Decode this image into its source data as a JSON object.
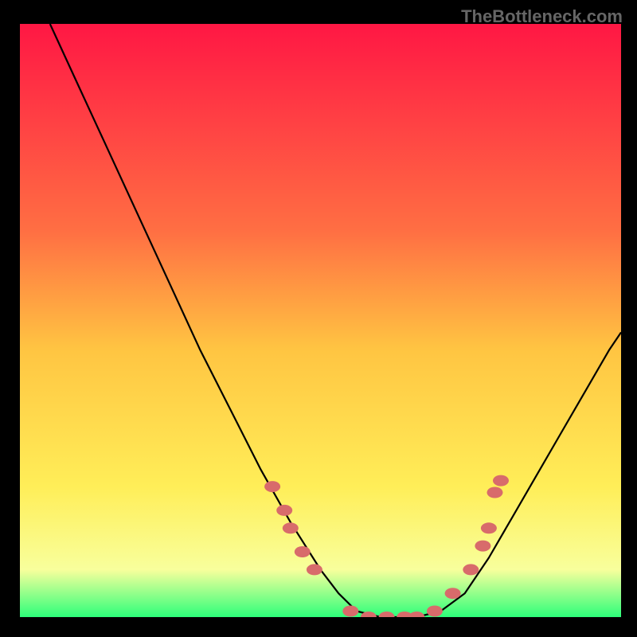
{
  "watermark": "TheBottleneck.com",
  "chart_data": {
    "type": "line",
    "title": "",
    "xlabel": "",
    "ylabel": "",
    "xlim": [
      0,
      100
    ],
    "ylim": [
      0,
      100
    ],
    "gradient_stops": [
      {
        "offset": 0,
        "color": "#ff1744"
      },
      {
        "offset": 35,
        "color": "#ff6f43"
      },
      {
        "offset": 55,
        "color": "#ffc542"
      },
      {
        "offset": 78,
        "color": "#ffee58"
      },
      {
        "offset": 92,
        "color": "#f8ff9c"
      },
      {
        "offset": 100,
        "color": "#2dff7a"
      }
    ],
    "series": [
      {
        "name": "bottleneck-curve",
        "x": [
          5,
          10,
          15,
          20,
          25,
          30,
          35,
          40,
          45,
          50,
          53,
          56,
          60,
          63,
          66,
          70,
          74,
          78,
          82,
          86,
          90,
          94,
          98,
          100
        ],
        "y": [
          100,
          89,
          78,
          67,
          56,
          45,
          35,
          25,
          16,
          8,
          4,
          1,
          0,
          0,
          0,
          1,
          4,
          10,
          17,
          24,
          31,
          38,
          45,
          48
        ]
      }
    ],
    "markers": {
      "name": "scatter-points",
      "color": "#d86b6b",
      "points": [
        {
          "x": 42,
          "y": 22
        },
        {
          "x": 44,
          "y": 18
        },
        {
          "x": 45,
          "y": 15
        },
        {
          "x": 47,
          "y": 11
        },
        {
          "x": 49,
          "y": 8
        },
        {
          "x": 55,
          "y": 1
        },
        {
          "x": 58,
          "y": 0
        },
        {
          "x": 61,
          "y": 0
        },
        {
          "x": 64,
          "y": 0
        },
        {
          "x": 66,
          "y": 0
        },
        {
          "x": 69,
          "y": 1
        },
        {
          "x": 72,
          "y": 4
        },
        {
          "x": 75,
          "y": 8
        },
        {
          "x": 77,
          "y": 12
        },
        {
          "x": 78,
          "y": 15
        },
        {
          "x": 79,
          "y": 21
        },
        {
          "x": 80,
          "y": 23
        }
      ]
    }
  }
}
